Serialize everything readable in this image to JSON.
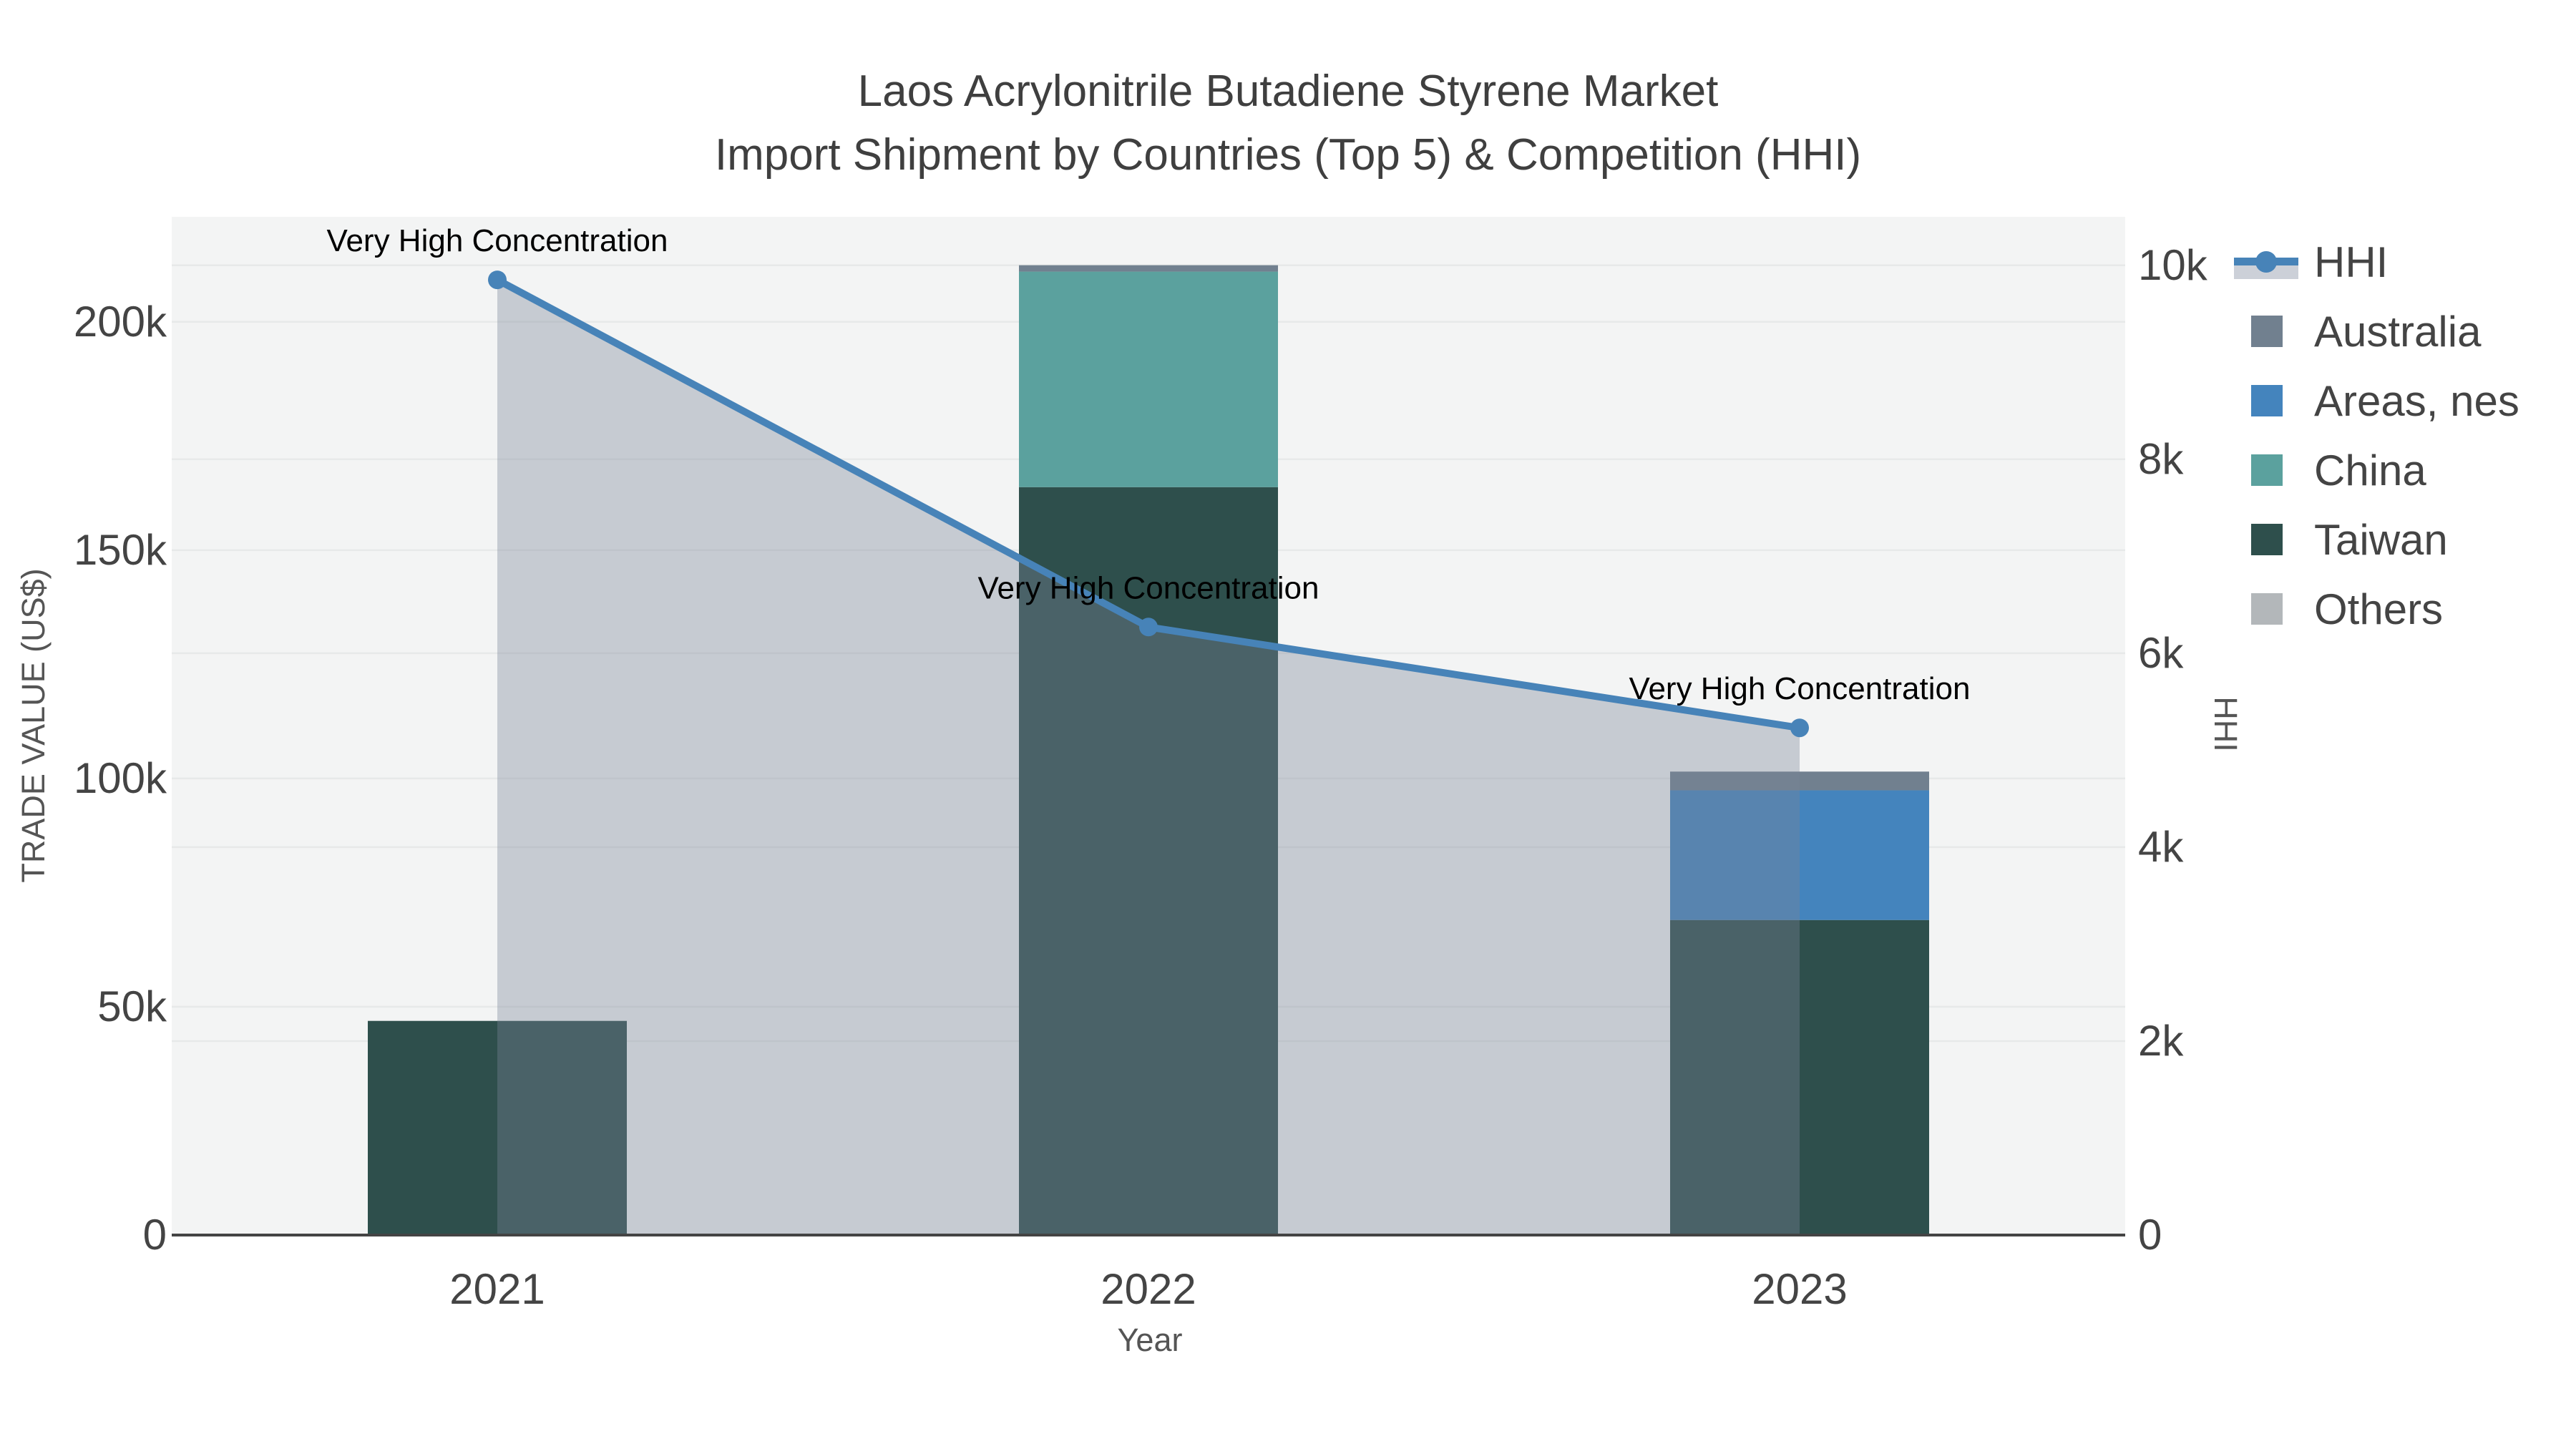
{
  "figure": {
    "title_line1": "Laos Acrylonitrile Butadiene Styrene Market",
    "title_line2": "Import Shipment by Countries (Top 5) & Competition (HHI)"
  },
  "axes": {
    "x": {
      "title": "Year",
      "tick_labels": [
        "2021",
        "2022",
        "2023"
      ]
    },
    "y_left": {
      "title": "TRADE VALUE (US$)",
      "tick_labels": [
        "0",
        "50k",
        "100k",
        "150k",
        "200k"
      ],
      "tick_values": [
        0,
        50000,
        100000,
        150000,
        200000
      ],
      "range": [
        0,
        223000
      ]
    },
    "y_right": {
      "title": "HHI",
      "tick_labels": [
        "0",
        "2k",
        "4k",
        "6k",
        "8k",
        "10k"
      ],
      "tick_values": [
        0,
        2000,
        4000,
        6000,
        8000,
        10000
      ],
      "range": [
        0,
        10500
      ]
    }
  },
  "chart_data": {
    "type": "bar+line",
    "categories": [
      "2021",
      "2022",
      "2023"
    ],
    "bar_mode": "stack",
    "series": [
      {
        "name": "Australia",
        "color": "#71808f",
        "values": [
          0,
          1400,
          4100
        ]
      },
      {
        "name": "Areas, nes",
        "color": "#4484bd",
        "values": [
          0,
          0,
          28400
        ]
      },
      {
        "name": "China",
        "color": "#5ba19e",
        "values": [
          0,
          47200,
          0
        ]
      },
      {
        "name": "Taiwan",
        "color": "#2e4f4c",
        "values": [
          46900,
          163800,
          69000
        ]
      },
      {
        "name": "Others",
        "color": "#b3b7ba",
        "values": [
          0,
          0,
          0
        ]
      }
    ],
    "line_series": {
      "name": "HHI",
      "color": "#4783b8",
      "area_fill_color": "rgba(123,132,153,0.37)",
      "values": [
        9850,
        6270,
        5230
      ]
    },
    "annotations": [
      {
        "x": "2021",
        "text": "Very High Concentration"
      },
      {
        "x": "2022",
        "text": "Very High Concentration"
      },
      {
        "x": "2023",
        "text": "Very High Concentration"
      }
    ],
    "title": "Laos Acrylonitrile Butadiene Styrene Market Import Shipment by Countries (Top 5) & Competition (HHI)",
    "xlabel": "Year",
    "ylabel_left": "TRADE VALUE (US$)",
    "ylabel_right": "HHI",
    "grid": true,
    "legend_position": "right-top"
  },
  "legend": {
    "items": [
      "HHI",
      "Australia",
      "Areas, nes",
      "China",
      "Taiwan",
      "Others"
    ]
  },
  "colors": {
    "plot_bg": "#f3f4f4",
    "grid_line": "#e7e9e9",
    "axis_line": "#444444"
  }
}
